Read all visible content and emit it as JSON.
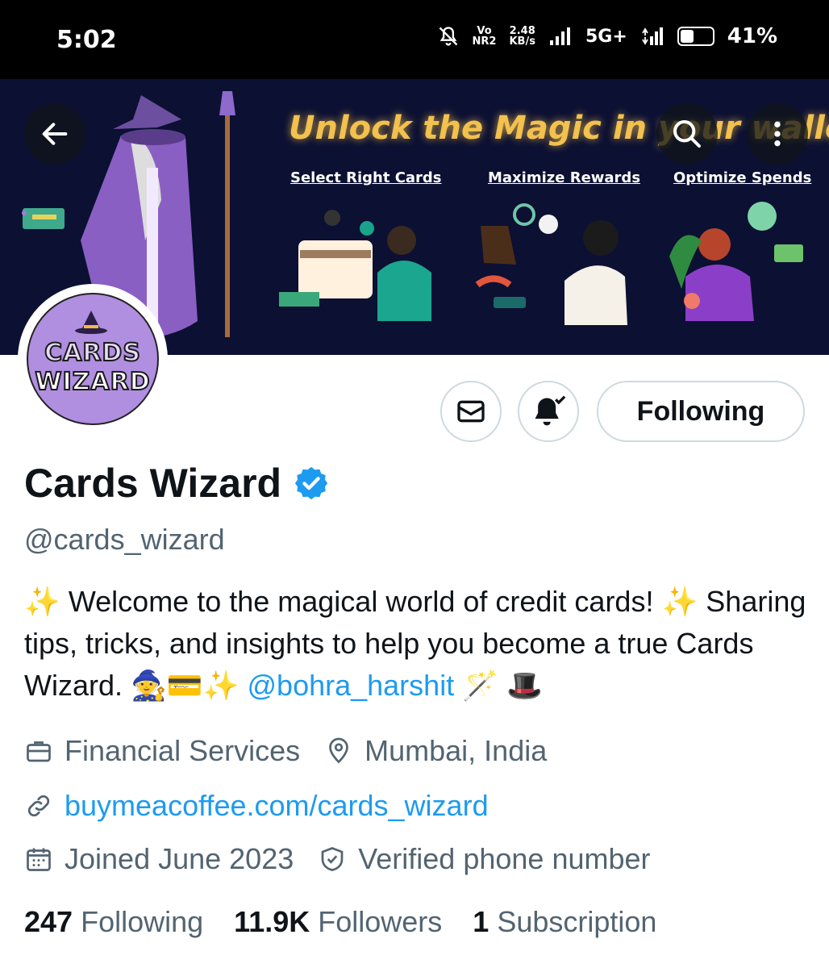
{
  "status_bar": {
    "time": "5:02",
    "vo_top": "Vo",
    "vo_bottom": "NR2",
    "speed_top": "2.48",
    "speed_bottom": "KB/s",
    "network": "5G+",
    "battery_level": 0.41,
    "battery_pct": "41%"
  },
  "banner": {
    "headline": "Unlock the Magic in your wallet",
    "sub1": "Select Right Cards",
    "sub2": "Maximize Rewards",
    "sub3": "Optimize Spends"
  },
  "avatar": {
    "line1": "CARDS",
    "line2": "WIZARD"
  },
  "actions": {
    "following_label": "Following"
  },
  "profile": {
    "name": "Cards Wizard",
    "handle": "@cards_wizard",
    "bio_part1": "✨ Welcome to the magical world of credit cards! ✨ Sharing tips, tricks, and insights to help you become a true Cards Wizard. 🧙💳✨",
    "bio_mention": "@bohra_harshit",
    "bio_part2": "🪄 🎩",
    "category": "Financial Services",
    "location": "Mumbai, India",
    "website": "buymeacoffee.com/cards_wizard",
    "joined": "Joined June 2023",
    "verified_phone": "Verified phone number"
  },
  "stats": {
    "following_count": "247",
    "following_label": "Following",
    "followers_count": "11.9K",
    "followers_label": "Followers",
    "subscription_count": "1",
    "subscription_label": "Subscription"
  },
  "colors": {
    "accent": "#1d9bf0",
    "secondary_text": "#536471",
    "banner_bg": "#0c1033",
    "headline_gold": "#f2c14e",
    "avatar_purple": "#b08ee0"
  }
}
